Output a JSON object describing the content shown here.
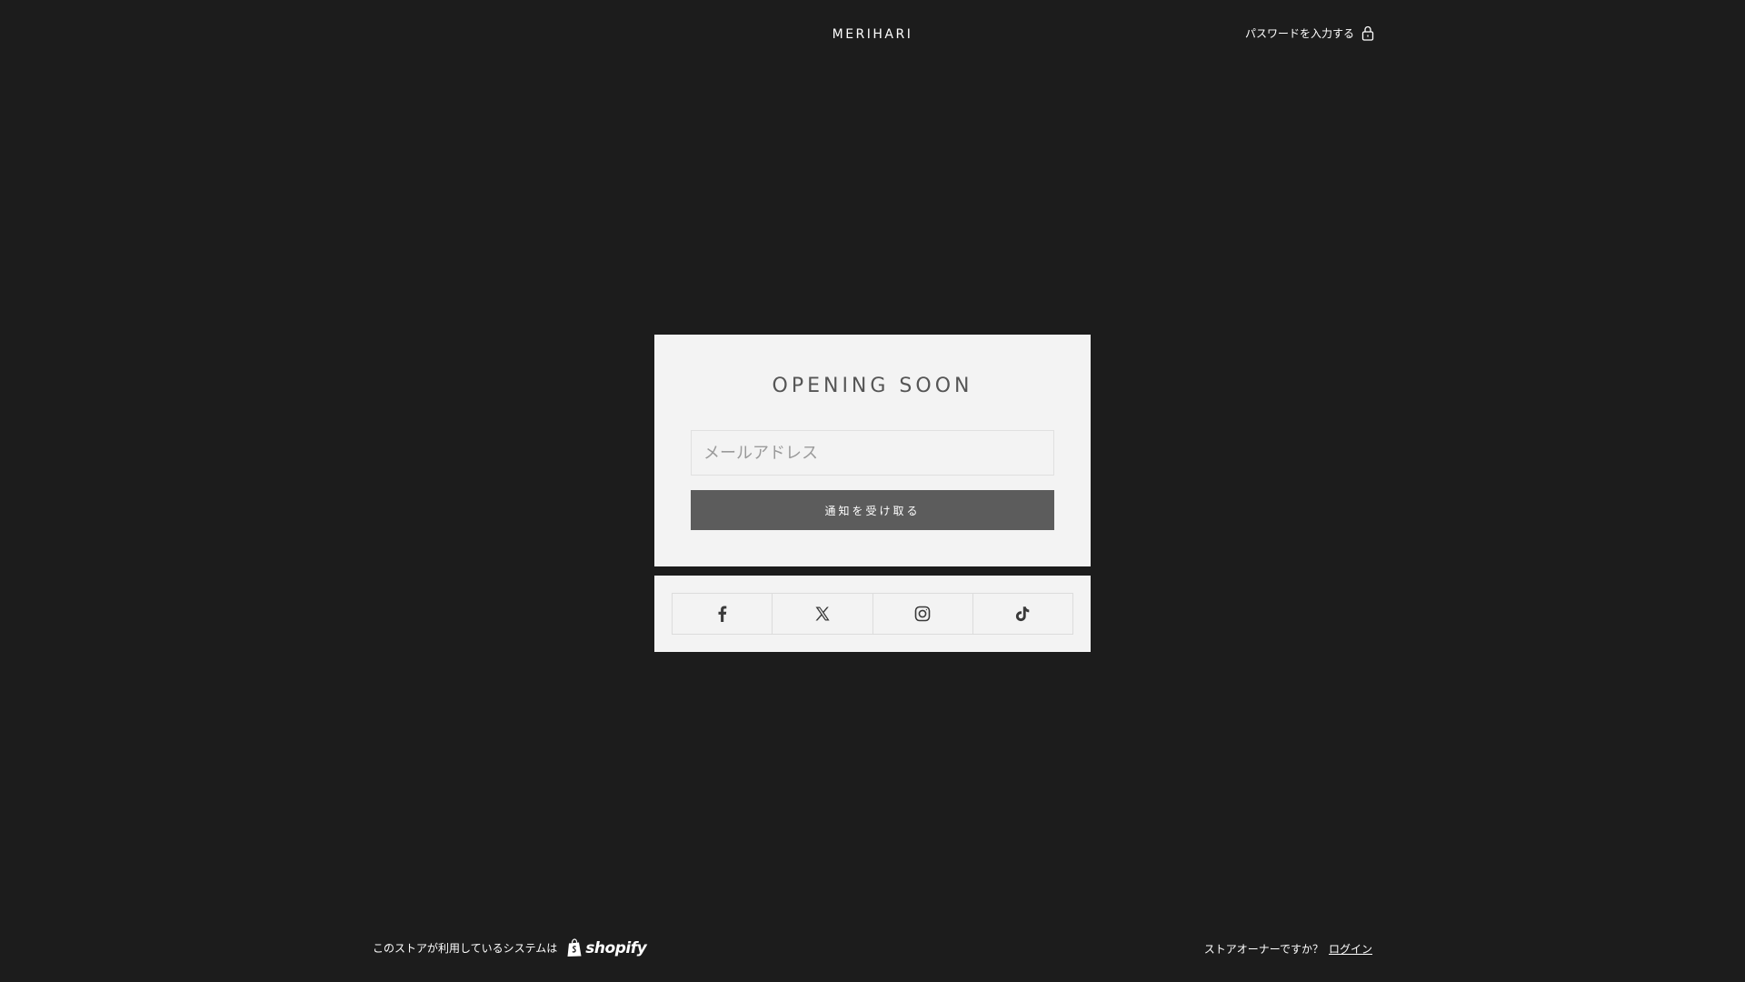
{
  "header": {
    "brand": "MERIHARI",
    "password_link_label": "パスワードを入力する",
    "password_icon": "lock-icon"
  },
  "card": {
    "title": "OPENING SOON",
    "email_placeholder": "メールアドレス",
    "email_value": "",
    "notify_button_label": "通知を受け取る"
  },
  "social": {
    "items": [
      {
        "name": "facebook",
        "icon": "facebook-icon"
      },
      {
        "name": "x",
        "icon": "x-icon"
      },
      {
        "name": "instagram",
        "icon": "instagram-icon"
      },
      {
        "name": "tiktok",
        "icon": "tiktok-icon"
      }
    ]
  },
  "footer": {
    "powered_by_label": "このストアが利用しているシステムは",
    "platform_name": "shopify",
    "owner_question": "ストアオーナーですか？",
    "login_label": "ログイン"
  },
  "colors": {
    "background": "#1c1c1c",
    "card": "#f3f3f3",
    "button": "#5c5c5c",
    "title_text": "#555555"
  }
}
